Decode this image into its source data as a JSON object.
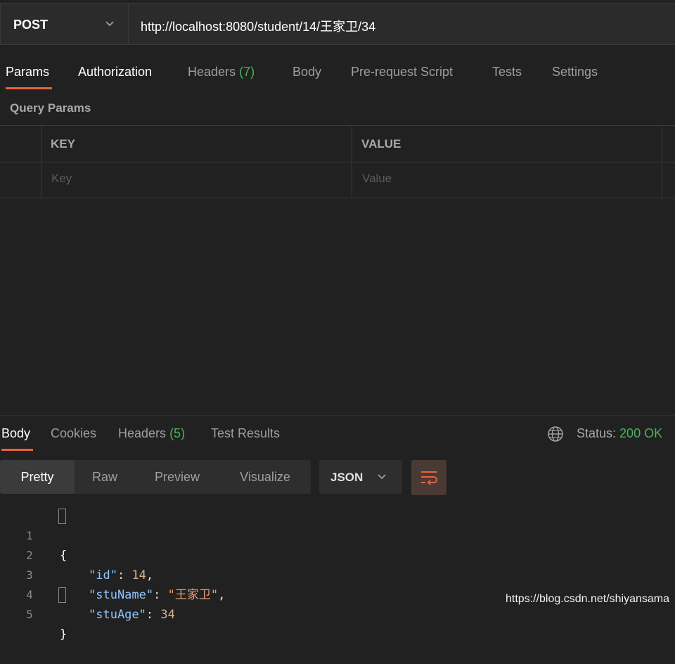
{
  "request": {
    "method": "POST",
    "url": "http://localhost:8080/student/14/王家卫/34"
  },
  "request_tabs": {
    "params": "Params",
    "authorization": "Authorization",
    "headers": "Headers",
    "headers_count": "(7)",
    "body": "Body",
    "prerequest": "Pre-request Script",
    "tests": "Tests",
    "settings": "Settings"
  },
  "query_params": {
    "title": "Query Params",
    "columns": {
      "key": "KEY",
      "value": "VALUE"
    },
    "placeholders": {
      "key": "Key",
      "value": "Value"
    }
  },
  "response_tabs": {
    "body": "Body",
    "cookies": "Cookies",
    "headers": "Headers",
    "headers_count": "(5)",
    "test_results": "Test Results"
  },
  "status": {
    "label": "Status:",
    "value": "200 OK"
  },
  "view_modes": {
    "pretty": "Pretty",
    "raw": "Raw",
    "preview": "Preview",
    "visualize": "Visualize"
  },
  "format": "JSON",
  "code": {
    "line_numbers": [
      "1",
      "2",
      "3",
      "4",
      "5"
    ],
    "open_brace": "{",
    "close_brace": "}",
    "id_key": "\"id\"",
    "id_value": "14",
    "name_key": "\"stuName\"",
    "name_value": "\"王家卫\"",
    "age_key": "\"stuAge\"",
    "age_value": "34"
  },
  "watermark": "https://blog.csdn.net/shiyansama",
  "colors": {
    "accent": "#e8633a",
    "success": "#49b35a",
    "background": "#212121"
  }
}
